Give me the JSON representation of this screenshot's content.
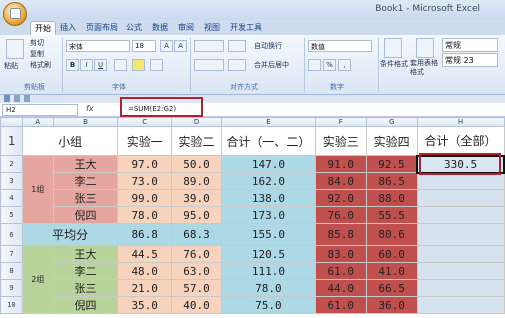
{
  "window": {
    "title": "Book1 - Microsoft Excel"
  },
  "tabs": [
    "开始",
    "插入",
    "页面布局",
    "公式",
    "数据",
    "审阅",
    "视图",
    "开发工具"
  ],
  "ribbon": {
    "clipboard": {
      "paste": "粘贴",
      "cut": "剪切",
      "copy": "复制",
      "format_painter": "格式刷",
      "label": "剪贴板"
    },
    "font": {
      "name": "宋体",
      "size": "18",
      "grow": "A",
      "shrink": "A",
      "bold": "B",
      "italic": "I",
      "underline": "U",
      "label": "字体"
    },
    "alignment": {
      "wrap": "自动换行",
      "merge": "合并后居中",
      "label": "对齐方式"
    },
    "number": {
      "format": "数值",
      "percent": "%",
      "comma": ",",
      "label": "数字"
    },
    "styles": {
      "conditional": "条件格式",
      "table": "套用表格格式",
      "normal": "常规",
      "normal23": "常规 23"
    }
  },
  "formula_bar": {
    "name_box": "H2",
    "fx": "fx",
    "formula": "=SUM(E2:G2)"
  },
  "columns": [
    "A",
    "B",
    "C",
    "D",
    "E",
    "F",
    "G",
    "H"
  ],
  "rows": [
    "1",
    "2",
    "3",
    "4",
    "5",
    "6",
    "7",
    "8",
    "9",
    "10"
  ],
  "grid": {
    "header": [
      "小组",
      "实验一",
      "实验二",
      "合计（一、二）",
      "实验三",
      "实验四",
      "合计（全部）"
    ],
    "group1": "1组",
    "group2": "2组",
    "avg_label": "平均分",
    "g1": [
      {
        "name": "王大",
        "e1": "97.0",
        "e2": "50.0",
        "sum": "147.0",
        "e3": "91.0",
        "e4": "92.5",
        "total": "330.5"
      },
      {
        "name": "李二",
        "e1": "73.0",
        "e2": "89.0",
        "sum": "162.0",
        "e3": "84.0",
        "e4": "86.5",
        "total": ""
      },
      {
        "name": "张三",
        "e1": "99.0",
        "e2": "39.0",
        "sum": "138.0",
        "e3": "92.0",
        "e4": "88.0",
        "total": ""
      },
      {
        "name": "倪四",
        "e1": "78.0",
        "e2": "95.0",
        "sum": "173.0",
        "e3": "76.0",
        "e4": "55.5",
        "total": ""
      }
    ],
    "avg": {
      "e1": "86.8",
      "e2": "68.3",
      "sum": "155.0",
      "e3": "85.8",
      "e4": "80.6"
    },
    "g2": [
      {
        "name": "王大",
        "e1": "44.5",
        "e2": "76.0",
        "sum": "120.5",
        "e3": "83.0",
        "e4": "60.0"
      },
      {
        "name": "李二",
        "e1": "48.0",
        "e2": "63.0",
        "sum": "111.0",
        "e3": "61.0",
        "e4": "41.0"
      },
      {
        "name": "张三",
        "e1": "21.0",
        "e2": "57.0",
        "sum": "78.0",
        "e3": "44.0",
        "e4": "66.5"
      },
      {
        "name": "倪四",
        "e1": "35.0",
        "e2": "40.0",
        "sum": "75.0",
        "e3": "61.0",
        "e4": "36.0"
      }
    ]
  },
  "colors": {
    "highlight": "#b02030",
    "accent": "#15428b"
  }
}
